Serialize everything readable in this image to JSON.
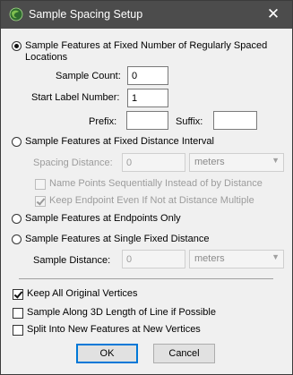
{
  "window": {
    "title": "Sample Spacing Setup",
    "close_glyph": "✕"
  },
  "options": {
    "fixed_count": {
      "label": "Sample Features at Fixed Number of Regularly Spaced Locations",
      "selected": true
    },
    "sample_count": {
      "label": "Sample Count:",
      "value": "0"
    },
    "start_label": {
      "label": "Start Label Number:",
      "value": "1"
    },
    "prefix": {
      "label": "Prefix:",
      "value": ""
    },
    "suffix": {
      "label": "Suffix:",
      "value": ""
    },
    "fixed_distance": {
      "label": "Sample Features at Fixed Distance Interval",
      "selected": false
    },
    "spacing_distance": {
      "label": "Spacing Distance:",
      "value": "0",
      "unit": "meters"
    },
    "name_points": {
      "label": "Name Points Sequentially Instead of by Distance",
      "checked": false
    },
    "keep_endpoint": {
      "label": "Keep Endpoint Even If Not at Distance Multiple",
      "checked": true
    },
    "endpoints_only": {
      "label": "Sample Features at Endpoints Only",
      "selected": false
    },
    "single_fixed": {
      "label": "Sample Features at Single Fixed Distance",
      "selected": false
    },
    "sample_distance": {
      "label": "Sample Distance:",
      "value": "0",
      "unit": "meters"
    }
  },
  "checks": {
    "keep_vertices": {
      "label": "Keep All Original Vertices",
      "checked": true
    },
    "along_3d": {
      "label": "Sample Along 3D Length of Line if Possible",
      "checked": false
    },
    "split_features": {
      "label": "Split Into New Features at New Vertices",
      "checked": false
    }
  },
  "buttons": {
    "ok": "OK",
    "cancel": "Cancel"
  },
  "icons": {
    "app": "globe-map-icon",
    "dropdown": "chevron-down-icon"
  },
  "colors": {
    "titlebar": "#4c4c4c",
    "dialog_bg": "#f0f0f0",
    "default_button_border": "#0078d7"
  }
}
